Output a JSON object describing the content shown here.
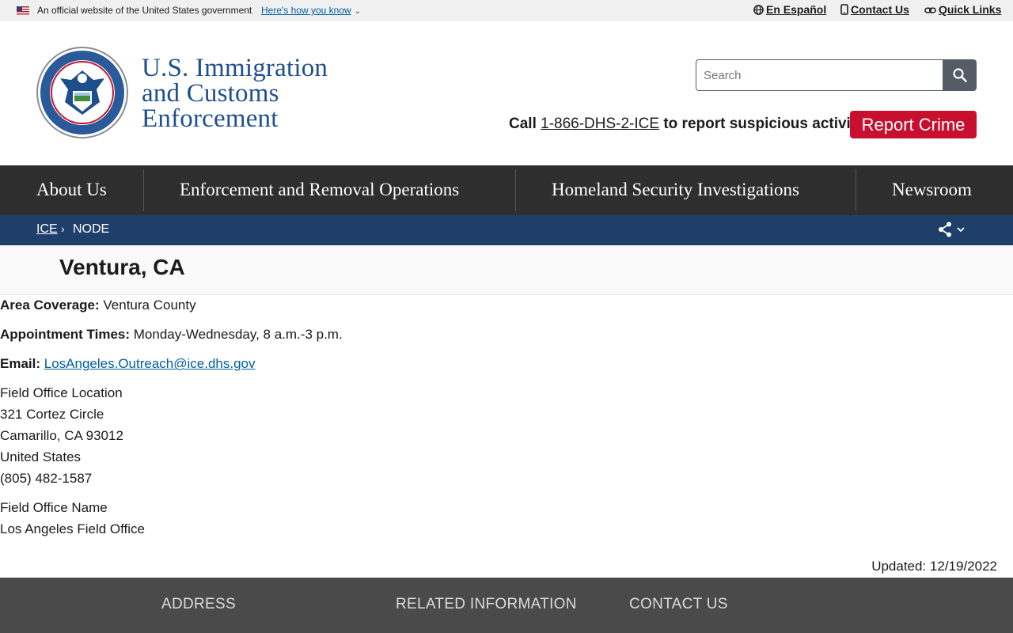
{
  "gov_banner": {
    "text": "An official website of the United States government",
    "link": "Here's how you know",
    "links": [
      "En Español",
      "Contact Us",
      "Quick Links"
    ]
  },
  "header": {
    "agency_line1": "U.S. Immigration",
    "agency_line2": "and Customs",
    "agency_line3": "Enforcement",
    "search_placeholder": "Search",
    "call_prefix": "Call ",
    "call_phone": "1-866-DHS-2-ICE",
    "call_suffix": " to report suspicious activity",
    "report_button": "Report Crime"
  },
  "nav": {
    "items": [
      "About Us",
      "Enforcement and Removal Operations",
      "Homeland Security Investigations",
      "Newsroom"
    ]
  },
  "breadcrumb": {
    "home": "ICE",
    "current": "NODE"
  },
  "page": {
    "title": "Ventura, CA",
    "area_label": "Area Coverage:",
    "area_value": " Ventura County",
    "appt_label": "Appointment Times:",
    "appt_value": " Monday-Wednesday, 8 a.m.-3 p.m.",
    "email_label": "Email:",
    "email_value": "LosAngeles.Outreach@ice.dhs.gov",
    "location_heading": "Field Office Location",
    "address_lines": [
      "321 Cortez Circle",
      "Camarillo, CA 93012",
      "United States",
      "(805) 482-1587"
    ],
    "office_name_heading": "Field Office Name",
    "office_name": "Los Angeles Field Office",
    "updated": "Updated: 12/19/2022"
  },
  "footer": {
    "headings": [
      "ADDRESS",
      "RELATED INFORMATION",
      "CONTACT US"
    ]
  },
  "colors": {
    "nav_bg": "#2e2e2e",
    "breadcrumb_bg": "#1f3f6b",
    "report_red": "#c8102e",
    "link_blue": "#005ea2",
    "agency_blue": "#1f4e8c"
  }
}
